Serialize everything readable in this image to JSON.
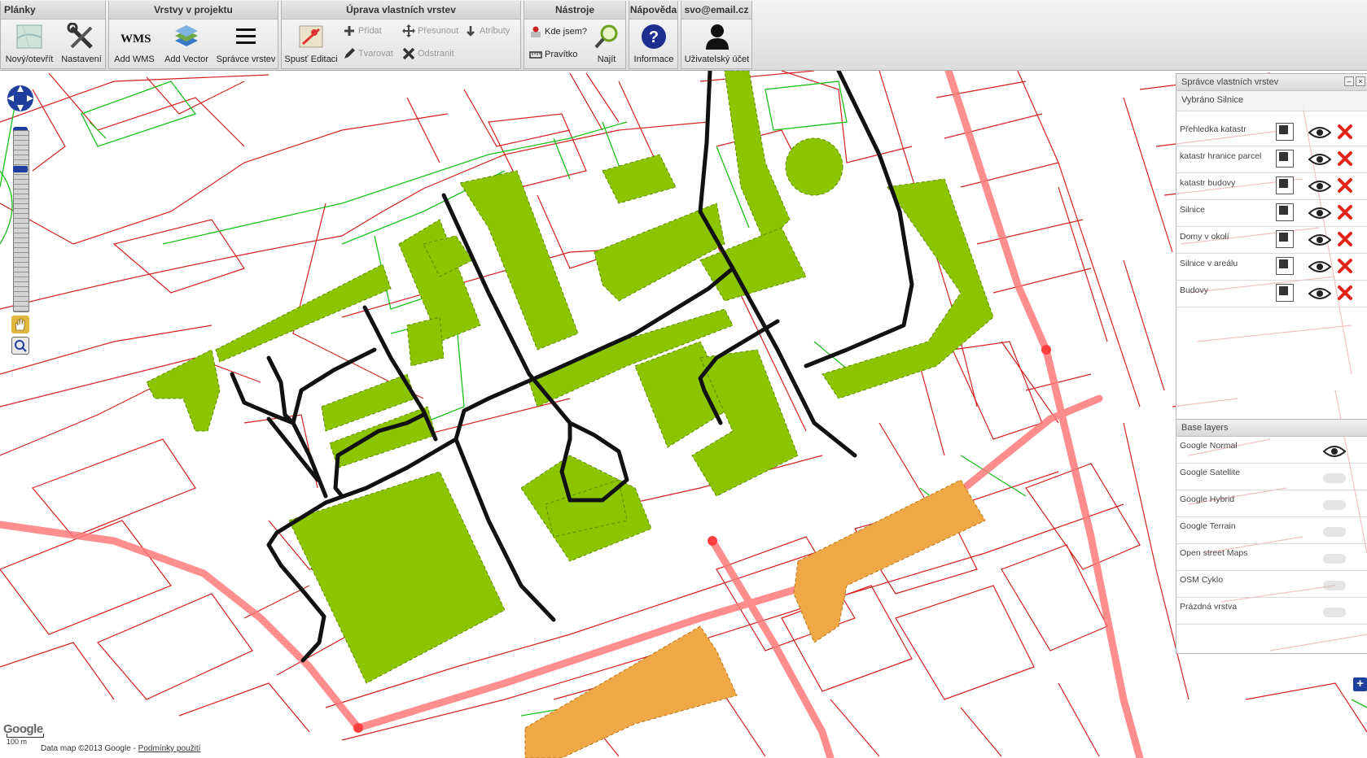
{
  "ribbon": {
    "groups": [
      {
        "title": "Plánky",
        "buttons": [
          {
            "label": "Nový/otevřít",
            "icon": "map-icon"
          },
          {
            "label": "Nastavení",
            "icon": "tools-icon"
          }
        ]
      },
      {
        "title": "Vrstvy v projektu",
        "buttons": [
          {
            "label": "Add WMS",
            "icon": "wms-icon"
          },
          {
            "label": "Add Vector",
            "icon": "layers-icon"
          },
          {
            "label": "Správce vrstev",
            "icon": "list-icon"
          }
        ]
      },
      {
        "title": "Úprava vlastních vrstev",
        "buttons": [
          {
            "label": "Spusť Editaci",
            "icon": "edit-map-icon"
          }
        ],
        "small": [
          {
            "label": "Přidat",
            "icon": "plus-icon"
          },
          {
            "label": "Přesunout",
            "icon": "move-icon"
          },
          {
            "label": "Atributy",
            "icon": "attributes-icon"
          },
          {
            "label": "Tvarovat",
            "icon": "pencil-icon"
          },
          {
            "label": "Odstranit",
            "icon": "delete-icon"
          }
        ]
      },
      {
        "title": "Nástroje",
        "small": [
          {
            "label": "Kde jsem?",
            "icon": "location-icon"
          },
          {
            "label": "Pravítko",
            "icon": "ruler-icon"
          }
        ],
        "buttons": [
          {
            "label": "Najít",
            "icon": "magnifier-icon"
          }
        ]
      },
      {
        "title": "Nápověda",
        "buttons": [
          {
            "label": "Informace",
            "icon": "help-icon"
          }
        ]
      },
      {
        "title": "svo@email.cz",
        "buttons": [
          {
            "label": "Uživatelský účet",
            "icon": "user-icon"
          }
        ]
      }
    ]
  },
  "layer_manager": {
    "title": "Správce vlastních vrstev",
    "selected": "Vybráno Silnice",
    "layers": [
      {
        "name": "Přehledka katastr"
      },
      {
        "name": "katastr hranice parcel"
      },
      {
        "name": "katastr budovy"
      },
      {
        "name": "Silnice"
      },
      {
        "name": "Domy v okolí"
      },
      {
        "name": "Silnice v areálu"
      },
      {
        "name": "Budovy"
      }
    ]
  },
  "base_layers": {
    "title": "Base layers",
    "layers": [
      {
        "name": "Google Normal",
        "visible": true
      },
      {
        "name": "Google Satellite",
        "visible": false
      },
      {
        "name": "Google Hybrid",
        "visible": false
      },
      {
        "name": "Google Terrain",
        "visible": false
      },
      {
        "name": "Open street Maps",
        "visible": false
      },
      {
        "name": "OSM Cyklo",
        "visible": false
      },
      {
        "name": "Prázdná vrstva",
        "visible": false
      }
    ]
  },
  "map": {
    "attribution": "Data map ©2013 Google -",
    "terms_link": "Podmínky použití",
    "logo": "Google",
    "scale": "100 m",
    "colors": {
      "parcel": "#d42020",
      "road_primary": "#ff7a7a",
      "road_internal": "#111111",
      "building": "#8cc400",
      "house": "#f0a846",
      "green": "#18c018"
    }
  }
}
